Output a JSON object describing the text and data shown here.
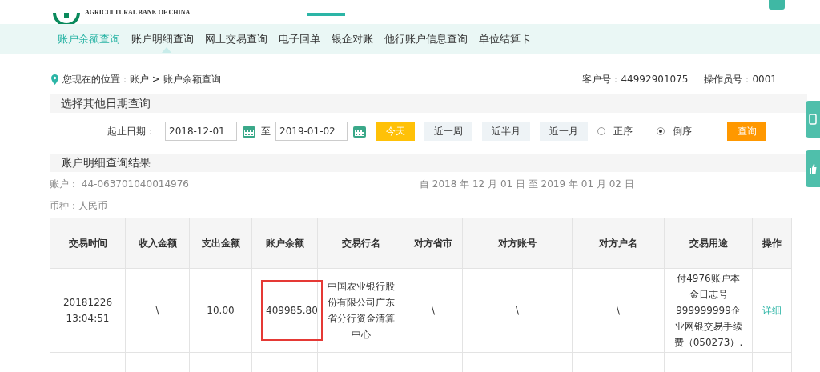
{
  "header": {
    "logo_text": "AGRICULTURAL BANK OF CHINA"
  },
  "subnav": [
    {
      "label": "账户余额查询",
      "selected": true
    },
    {
      "label": "账户明细查询",
      "selected": false
    },
    {
      "label": "网上交易查询",
      "selected": false
    },
    {
      "label": "电子回单",
      "selected": false
    },
    {
      "label": "银企对账",
      "selected": false
    },
    {
      "label": "他行账户信息查询",
      "selected": false
    },
    {
      "label": "单位结算卡",
      "selected": false
    }
  ],
  "breadcrumb": "您现在的位置：账户 > 账户余额查询",
  "customer": "客户号：44992901075",
  "operator": "操作员号：0001",
  "date_section": {
    "title": "选择其他日期查询",
    "label": "起止日期：",
    "start": "2018-12-01",
    "separator": "至",
    "end": "2019-01-02",
    "quick": [
      {
        "label": "今天",
        "selected": true
      },
      {
        "label": "近一周",
        "selected": false
      },
      {
        "label": "近半月",
        "selected": false
      },
      {
        "label": "近一月",
        "selected": false
      }
    ],
    "order": [
      {
        "label": "正序",
        "selected": false
      },
      {
        "label": "倒序",
        "selected": true
      }
    ],
    "submit": "查询"
  },
  "result": {
    "title": "账户明细查询结果",
    "account": "账户： 44-063701040014976",
    "range": "自 2018 年 12 月 01 日 至 2019 年 01 月 02 日",
    "currency": "币种：人民币"
  },
  "table": {
    "columns": [
      "交易时间",
      "收入金额",
      "支出金额",
      "账户余额",
      "交易行名",
      "对方省市",
      "对方账号",
      "对方户名",
      "交易用途",
      "操作"
    ],
    "rows": [
      {
        "cells": [
          {
            "text": "20181226 13:04:51",
            "framed": false
          },
          {
            "text": "\\",
            "framed": false
          },
          {
            "text": "10.00",
            "framed": false
          },
          {
            "text": "409985.80",
            "framed": true
          },
          {
            "text": "中国农业银行股份有限公司广东省分行资金清算中心",
            "framed": false
          },
          {
            "text": "\\",
            "framed": false
          },
          {
            "text": "\\",
            "framed": false
          },
          {
            "text": "\\",
            "framed": false
          },
          {
            "text": "付4976账户本金日志号999999999企业网银交易手续费（050273）.",
            "framed": false
          }
        ],
        "action": "详细"
      }
    ]
  }
}
